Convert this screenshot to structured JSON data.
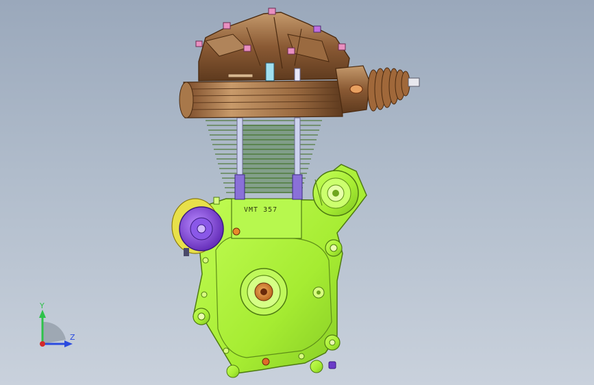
{
  "viewport": {
    "model_name": "single-cylinder-engine-assembly",
    "engraving": "VMT 357",
    "colors": {
      "background_top": "#9aa8bb",
      "background_bottom": "#c9d1dc",
      "head": "#8a5a34",
      "head_dark": "#5e3a1e",
      "head_light": "#b98b5e",
      "crankcase": "#aef23a",
      "crankcase_dark": "#6fa61e",
      "fins": "#3a6a1a",
      "pushrod": "#c8d0e8",
      "cover_purple": "#7a3ad8",
      "cover_yellow": "#e8e04a",
      "bolt_orange": "#e88a2a"
    }
  },
  "triad": {
    "y_label": "Y",
    "z_label": "Z",
    "y_color": "#2ec24a",
    "z_color": "#2a4adf",
    "origin_color": "#d22a2a"
  }
}
